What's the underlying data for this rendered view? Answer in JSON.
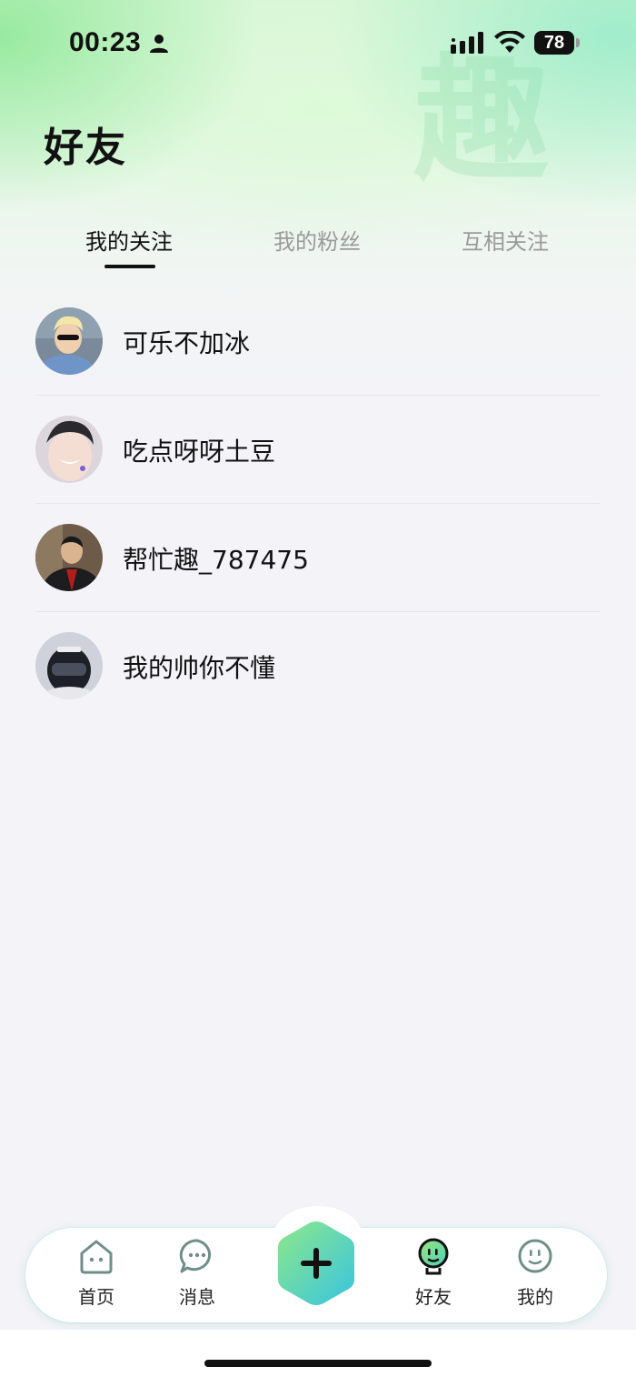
{
  "status_bar": {
    "time": "00:23",
    "battery": "78"
  },
  "header": {
    "title": "好友",
    "watermark": "趣"
  },
  "tabs": [
    {
      "label": "我的关注",
      "active": true
    },
    {
      "label": "我的粉丝",
      "active": false
    },
    {
      "label": "互相关注",
      "active": false
    }
  ],
  "friends": [
    {
      "name": "可乐不加冰"
    },
    {
      "name": "吃点呀呀土豆"
    },
    {
      "name": "帮忙趣_787475"
    },
    {
      "name": "我的帅你不懂"
    }
  ],
  "bottom_nav": {
    "home": "首页",
    "messages": "消息",
    "friends": "好友",
    "me": "我的"
  },
  "colors": {
    "accent_green": "#7fe08a",
    "accent_teal": "#3fc7d8"
  }
}
